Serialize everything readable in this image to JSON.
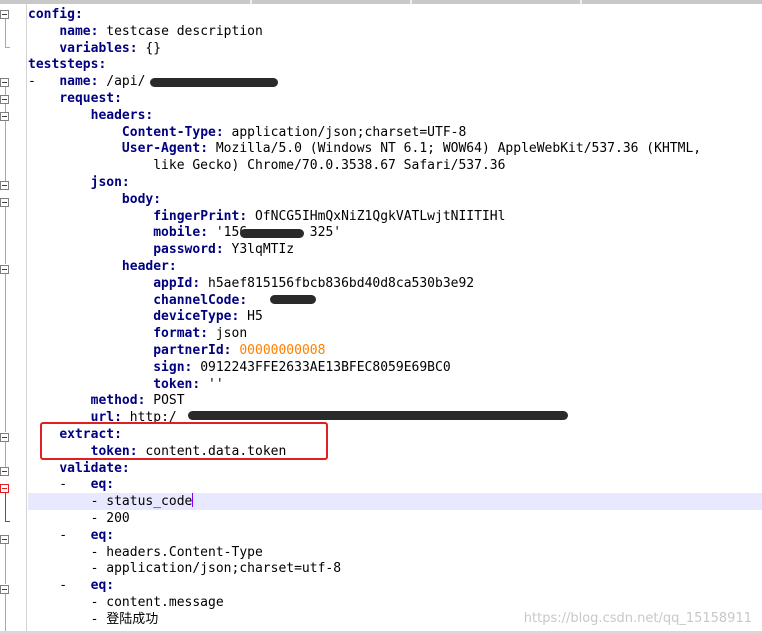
{
  "editor": {
    "highlighted_line": 30,
    "redacted_regions": [
      "teststeps.name",
      "mobile",
      "channelCode",
      "url"
    ],
    "annotation_box_color": "#e02020"
  },
  "lines": [
    [
      {
        "t": "config:",
        "c": "k"
      }
    ],
    [
      {
        "t": "    "
      },
      {
        "t": "name:",
        "c": "k"
      },
      {
        "t": " testcase description"
      }
    ],
    [
      {
        "t": "    "
      },
      {
        "t": "variables:",
        "c": "k"
      },
      {
        "t": " {}"
      }
    ],
    [
      {
        "t": "teststeps:",
        "c": "k"
      }
    ],
    [
      {
        "t": "-   "
      },
      {
        "t": "name:",
        "c": "k"
      },
      {
        "t": " /api/"
      }
    ],
    [
      {
        "t": "    "
      },
      {
        "t": "request:",
        "c": "k"
      }
    ],
    [
      {
        "t": "        "
      },
      {
        "t": "headers:",
        "c": "k"
      }
    ],
    [
      {
        "t": "            "
      },
      {
        "t": "Content-Type:",
        "c": "k"
      },
      {
        "t": " application/json;charset=UTF-8"
      }
    ],
    [
      {
        "t": "            "
      },
      {
        "t": "User-Agent:",
        "c": "k"
      },
      {
        "t": " Mozilla/5.0 (Windows NT 6.1; WOW64) AppleWebKit/537.36 (KHTML,"
      }
    ],
    [
      {
        "t": "                like Gecko) Chrome/70.0.3538.67 Safari/537.36"
      }
    ],
    [
      {
        "t": "        "
      },
      {
        "t": "json:",
        "c": "k"
      }
    ],
    [
      {
        "t": "            "
      },
      {
        "t": "body:",
        "c": "k"
      }
    ],
    [
      {
        "t": "                "
      },
      {
        "t": "fingerPrint:",
        "c": "k"
      },
      {
        "t": " OfNCG5IHmQxNiZ1QgkVATLwjtNIITIHl"
      }
    ],
    [
      {
        "t": "                "
      },
      {
        "t": "mobile:",
        "c": "k"
      },
      {
        "t": " '156"
      },
      {
        "t": "        "
      },
      {
        "t": "325'"
      }
    ],
    [
      {
        "t": "                "
      },
      {
        "t": "password:",
        "c": "k"
      },
      {
        "t": " Y3lqMTIz"
      }
    ],
    [
      {
        "t": "            "
      },
      {
        "t": "header:",
        "c": "k"
      }
    ],
    [
      {
        "t": "                "
      },
      {
        "t": "appId:",
        "c": "k"
      },
      {
        "t": " h5aef815156fbcb836bd40d8ca530b3e92"
      }
    ],
    [
      {
        "t": "                "
      },
      {
        "t": "channelCode:",
        "c": "k"
      },
      {
        "t": " "
      }
    ],
    [
      {
        "t": "                "
      },
      {
        "t": "deviceType:",
        "c": "k"
      },
      {
        "t": " H5"
      }
    ],
    [
      {
        "t": "                "
      },
      {
        "t": "format:",
        "c": "k"
      },
      {
        "t": " json"
      }
    ],
    [
      {
        "t": "                "
      },
      {
        "t": "partnerId:",
        "c": "k"
      },
      {
        "t": " "
      },
      {
        "t": "00000000008",
        "c": "n"
      }
    ],
    [
      {
        "t": "                "
      },
      {
        "t": "sign:",
        "c": "k"
      },
      {
        "t": " 0912243FFE2633AE13BFEC8059E69BC0"
      }
    ],
    [
      {
        "t": "                "
      },
      {
        "t": "token:",
        "c": "k"
      },
      {
        "t": " ''"
      }
    ],
    [
      {
        "t": "        "
      },
      {
        "t": "method:",
        "c": "k"
      },
      {
        "t": " POST"
      }
    ],
    [
      {
        "t": "        "
      },
      {
        "t": "url:",
        "c": "k"
      },
      {
        "t": " http:/"
      }
    ],
    [
      {
        "t": "    "
      },
      {
        "t": "extract:",
        "c": "k"
      }
    ],
    [
      {
        "t": "        "
      },
      {
        "t": "token:",
        "c": "k"
      },
      {
        "t": " content.data.token"
      }
    ],
    [
      {
        "t": "    "
      },
      {
        "t": "validate:",
        "c": "k"
      }
    ],
    [
      {
        "t": "    -   "
      },
      {
        "t": "eq:",
        "c": "k"
      }
    ],
    [
      {
        "t": "        - status_code"
      }
    ],
    [
      {
        "t": "        - 200"
      }
    ],
    [
      {
        "t": "    -   "
      },
      {
        "t": "eq:",
        "c": "k"
      }
    ],
    [
      {
        "t": "        - headers.Content-Type"
      }
    ],
    [
      {
        "t": "        - application/json;charset=utf-8"
      }
    ],
    [
      {
        "t": "    -   "
      },
      {
        "t": "eq:",
        "c": "k"
      }
    ],
    [
      {
        "t": "        - content.message"
      }
    ],
    [
      {
        "t": "        - 登陆成功"
      }
    ]
  ],
  "watermark": "https://blog.csdn.net/qq_15158911"
}
